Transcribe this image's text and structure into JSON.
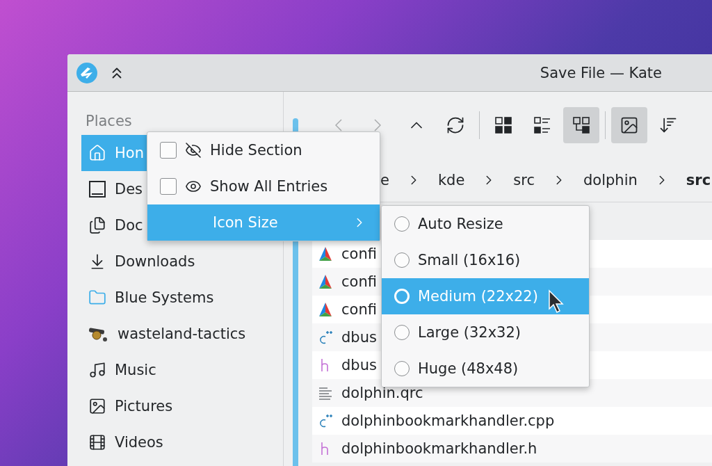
{
  "window": {
    "title": "Save File — Kate"
  },
  "places": {
    "heading": "Places",
    "items": [
      {
        "label": "Hon",
        "kind": "home",
        "selected": true
      },
      {
        "label": "Des",
        "kind": "desktop",
        "selected": false
      },
      {
        "label": "Doc",
        "kind": "documents",
        "selected": false
      },
      {
        "label": "Downloads",
        "kind": "downloads",
        "selected": false
      },
      {
        "label": "Blue Systems",
        "kind": "folder",
        "selected": false
      },
      {
        "label": "wasteland-tactics",
        "kind": "cannon",
        "selected": false
      },
      {
        "label": "Music",
        "kind": "music",
        "selected": false
      },
      {
        "label": "Pictures",
        "kind": "pictures",
        "selected": false
      },
      {
        "label": "Videos",
        "kind": "videos",
        "selected": false
      }
    ]
  },
  "toolbar": [
    {
      "kind": "back",
      "disabled": true,
      "selected": false
    },
    {
      "kind": "forward",
      "disabled": true,
      "selected": false
    },
    {
      "kind": "up",
      "disabled": false,
      "selected": false
    },
    {
      "kind": "reload",
      "disabled": false,
      "selected": false
    },
    {
      "kind": "separator"
    },
    {
      "kind": "icons",
      "disabled": false,
      "selected": false
    },
    {
      "kind": "compact",
      "disabled": false,
      "selected": false
    },
    {
      "kind": "details",
      "disabled": false,
      "selected": true
    },
    {
      "kind": "separator"
    },
    {
      "kind": "preview",
      "disabled": false,
      "selected": true
    },
    {
      "kind": "sort",
      "disabled": false,
      "selected": false
    }
  ],
  "breadcrumb": [
    {
      "label": "e",
      "selected": false
    },
    {
      "label": "kde",
      "selected": false
    },
    {
      "label": "src",
      "selected": false
    },
    {
      "label": "dolphin",
      "selected": false
    },
    {
      "label": "src",
      "selected": true
    }
  ],
  "files": [
    {
      "name": "confi",
      "kind": "cmake"
    },
    {
      "name": "confi",
      "kind": "cmake"
    },
    {
      "name": "confi",
      "kind": "cmake"
    },
    {
      "name": "dbus",
      "kind": "cpp"
    },
    {
      "name": "dbus",
      "kind": "header"
    },
    {
      "name": "dolphin.qrc",
      "kind": "text"
    },
    {
      "name": "dolphinbookmarkhandler.cpp",
      "kind": "cpp"
    },
    {
      "name": "dolphinbookmarkhandler.h",
      "kind": "header"
    }
  ],
  "context_menu": {
    "items": [
      {
        "kind": "hide",
        "label": "Hide Section",
        "checked": false,
        "selected": false
      },
      {
        "kind": "show",
        "label": "Show All Entries",
        "checked": false,
        "selected": false
      },
      {
        "kind": "submenu",
        "label": "Icon Size",
        "selected": true
      }
    ]
  },
  "icon_size_menu": {
    "items": [
      {
        "label": "Auto Resize",
        "checked": false,
        "selected": false
      },
      {
        "label": "Small (16x16)",
        "checked": false,
        "selected": false
      },
      {
        "label": "Medium (22x22)",
        "checked": false,
        "selected": true
      },
      {
        "label": "Large (32x32)",
        "checked": false,
        "selected": false
      },
      {
        "label": "Huge (48x48)",
        "checked": false,
        "selected": false
      }
    ]
  }
}
